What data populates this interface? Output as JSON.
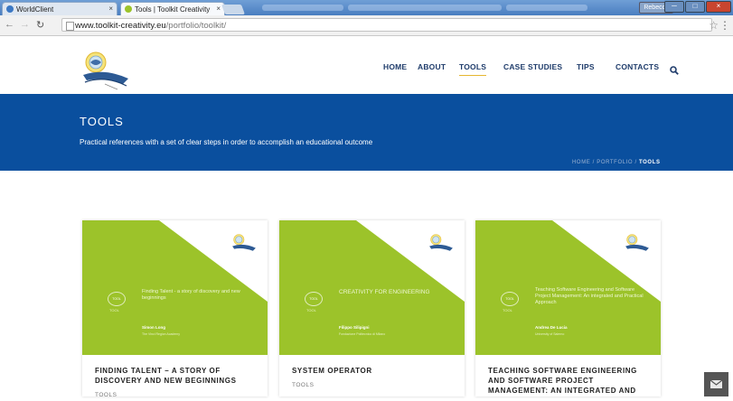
{
  "browser": {
    "tabs": [
      {
        "title": "WorldClient",
        "active": false
      },
      {
        "title": "Tools | Toolkit Creativity",
        "active": true
      }
    ],
    "url_host": "www.toolkit-creativity.eu",
    "url_path": "/portfolio/toolkit/",
    "user_badge": "Rebecca",
    "close_glyph": "×",
    "window_buttons": [
      "─",
      "□",
      "×"
    ]
  },
  "nav": {
    "items": [
      "HOME",
      "ABOUT",
      "TOOLS",
      "CASE STUDIES",
      "TIPS",
      "CONTACTS"
    ],
    "active": "TOOLS"
  },
  "banner": {
    "title": "TOOLS",
    "subtitle": "Practical references with a set of clear steps in order to accomplish an educational outcome",
    "breadcrumb": {
      "home": "HOME",
      "sep1": " / ",
      "portfolio": "PORTFOLIO",
      "sep2": " / ",
      "current": "TOOLS"
    }
  },
  "cards": [
    {
      "title": "FINDING TALENT – A STORY OF DISCOVERY AND NEW BEGINNINGS",
      "category": "TOOLS",
      "image_title": "Finding Talent - a story of discovery and new beginnings",
      "author": "Simon Long",
      "org": "The Vinci Region Academy",
      "badge_text": "TOOL"
    },
    {
      "title": "SYSTEM OPERATOR",
      "category": "TOOLS",
      "image_title": "CREATIVITY FOR ENGINEERING",
      "author": "Filippo Silipigni",
      "org": "Fondazione Politecnico di Milano",
      "badge_text": "TOOL"
    },
    {
      "title": "TEACHING SOFTWARE ENGINEERING AND SOFTWARE PROJECT MANAGEMENT: AN INTEGRATED AND",
      "category": "",
      "image_title": "Teaching Software Engineering and Software Project Management: An integrated and Practical Approach",
      "author": "Andrea De Lucia",
      "org": "University of Salerno",
      "badge_text": "TOOL"
    }
  ],
  "colors": {
    "banner_blue": "#0a4f9e",
    "card_green": "#9cc32a",
    "nav_text": "#1f3c6b",
    "nav_active_underline": "#e5b632"
  },
  "icons": {
    "search": "search-icon",
    "mail": "mail-icon",
    "star": "star-icon",
    "menu": "menu-icon"
  }
}
